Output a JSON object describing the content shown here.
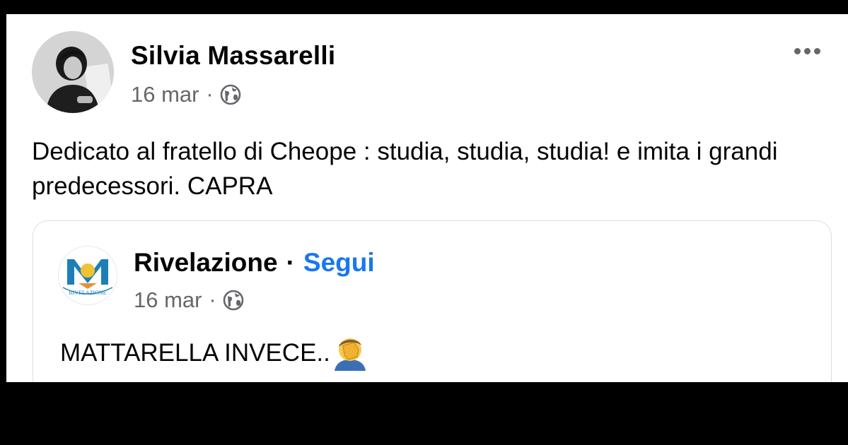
{
  "post": {
    "author": "Silvia Massarelli",
    "date": "16 mar",
    "separator": "·",
    "privacy_icon": "globe-icon",
    "more_icon": "more-options-icon",
    "text": "Dedicato al fratello di Cheope : studia, studia, studia! e imita i grandi predecessori. CAPRA"
  },
  "shared_post": {
    "page_name": "Rivelazione",
    "separator": "·",
    "follow_label": "Segui",
    "date": "16 mar",
    "logo_text": "RIVELAZIONE",
    "privacy_icon": "globe-icon",
    "text": "MATTARELLA INVECE..",
    "emoji": "🤦‍♂️",
    "emoji_icon": "facepalm-emoji-icon"
  },
  "colors": {
    "accent": "#1877f2",
    "meta_gray": "#65676b",
    "text": "#050505"
  }
}
